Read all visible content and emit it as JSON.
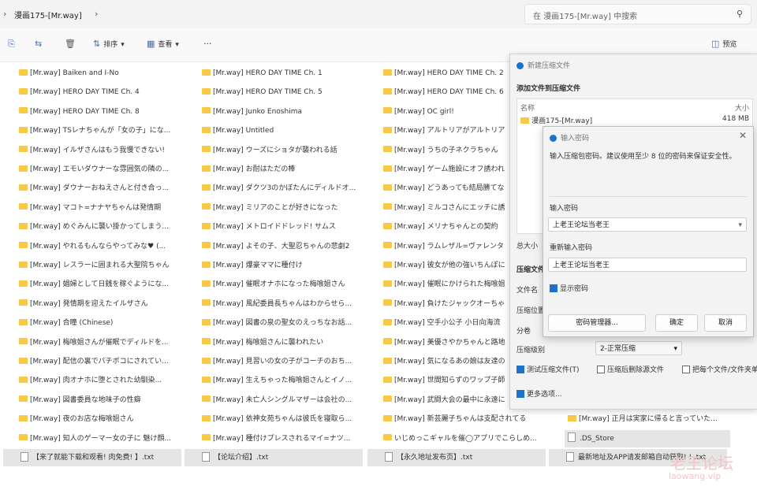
{
  "address": {
    "breadcrumb": "漫画175-[Mr.way]",
    "search_placeholder": "在 漫画175-[Mr.way] 中搜索"
  },
  "toolbar": {
    "sort": "排序",
    "view": "查看",
    "more": "···",
    "preview": "预览"
  },
  "files": {
    "col1": [
      "[Mr.way] Baiken and I-No",
      "[Mr.way] HERO DAY TIME Ch. 4",
      "[Mr.way] HERO DAY TIME Ch. 8",
      "[Mr.way] TSレナちゃんが「女の子」にな...",
      "[Mr.way] イルザさんはもう我慢できない!",
      "[Mr.way] エモいダウナーな雰囲気の隣の...",
      "[Mr.way] ダウナーおねえさんと付き合っ...",
      "[Mr.way] マコト=ナナヤちゃんは発情期",
      "[Mr.way] めぐみんに襲い掛かってしまう...",
      "[Mr.way] やれるもんならやってみな♥ (...",
      "[Mr.way] レスラーに囲まれる大聖院ちゃん",
      "[Mr.way] 娼婦として日銭を稼ぐようにな...",
      "[Mr.way] 発情期を迎えたイルザさん",
      "[Mr.way] 合瞳 (Chinese)",
      "[Mr.way] 梅喰姐さんが催眠でディルドを...",
      "[Mr.way] 配信の裏でパチボコにされてい...",
      "[Mr.way] 肉オナホに堕とされた幼馴染...",
      "[Mr.way] 図書委員な地味子の性癖",
      "[Mr.way] 夜のお店な梅喰姐さん",
      "[Mr.way] 知人のゲーマー女の子に 魅け顔..."
    ],
    "col2": [
      "[Mr.way] HERO DAY TIME Ch. 1",
      "[Mr.way] HERO DAY TIME Ch. 5",
      "[Mr.way] Junko Enoshima",
      "[Mr.way] Untitled",
      "[Mr.way] ウーズにショタが襲われる話",
      "[Mr.way] お耐はただの棒",
      "[Mr.way] ダクツ3のかぼたんにディルドオ...",
      "[Mr.way] ミリアのことが好きになった",
      "[Mr.way] メトロイドドレッド! サムス",
      "[Mr.way] よその子、大聖忍ちゃんの悲劇2",
      "[Mr.way] 爆豪ママに種付け",
      "[Mr.way] 催眠オナホになった梅喰姐さん",
      "[Mr.way] 風紀委員長ちゃんはわからせら...",
      "[Mr.way] 図書の泉の聖女のえっちなお話...",
      "[Mr.way] 梅喰姐さんに襲われたい",
      "[Mr.way] 見習いの女の子がコーチのおち...",
      "[Mr.way] 生えちゃった梅喰姐さんとイノ...",
      "[Mr.way] 未亡人シングルマザーは会社の...",
      "[Mr.way] 依神女苑ちゃんは彼氏を寝取ら...",
      "[Mr.way] 種付けプレスされるマイ=ナツ..."
    ],
    "col3": [
      "[Mr.way] HERO DAY TIME Ch. 2",
      "[Mr.way] HERO DAY TIME Ch. 6",
      "[Mr.way] OC girl!",
      "[Mr.way] アルトリアがアルトリア",
      "[Mr.way] うちの子ネクラちゃん",
      "[Mr.way] ゲーム施設にオフ誘われ",
      "[Mr.way] どうあっても結局勝てな",
      "[Mr.way] ミルコさんにエッチに誘",
      "[Mr.way] メリナちゃんとの契約",
      "[Mr.way] ラムレザル=ヴァレンタ",
      "[Mr.way] 彼女が他の強いちんぽに",
      "[Mr.way] 催眠にかけられた梅喰姐",
      "[Mr.way] 負けたジャックオーちゃ",
      "[Mr.way] 空手小公子 小日向海流",
      "[Mr.way] 美優さやかちゃんと路地",
      "[Mr.way] 気になるあの娘は友達の",
      "[Mr.way] 世間知らずのワップ子師",
      "[Mr.way] 武闘大会の最中に永遠に",
      "[Mr.way] 新芸麗子ちゃんは支配されてる",
      "いじめっこギャルを催◯アプリでこらしめ..."
    ],
    "col4_bottom": [
      "[Mr.way] 正月は実家に帰ると言っていた...",
      ".DS_Store"
    ],
    "txt_row": [
      "【来了就能下载和观看! 肉免费! 】.txt",
      "【论坛介绍】.txt",
      "【永久地址发布页】.txt",
      "最新地址及APP请发邮箱自动获取! ! .txt"
    ]
  },
  "compress_dialog": {
    "title": "新建压缩文件",
    "section": "添加文件到压缩文件",
    "col_name": "名称",
    "col_size": "大小",
    "item_name": "漫画175-[Mr.way]",
    "item_size": "418 MB",
    "lbl_total": "总大小",
    "lbl_format": "压缩文件",
    "lbl_filename": "文件名",
    "lbl_location": "压缩位置",
    "lbl_split": "分卷",
    "lbl_level": "压缩级别",
    "level_value": "2-正常压缩",
    "opt_test": "测试压缩文件(T)",
    "opt_delete": "压缩后删除源文件",
    "opt_each": "把每个文件/文件夹单独",
    "more_options": "更多选项..."
  },
  "password_dialog": {
    "title": "输入密码",
    "desc": "输入压缩包密码。建议使用至少 8 位的密码来保证安全性。",
    "lbl_password": "输入密码",
    "password_value": "上老王论坛当老王",
    "lbl_repeat": "重新输入密码",
    "repeat_value": "上老王论坛当老王",
    "show_password": "显示密码",
    "btn_manager": "密码管理器...",
    "btn_ok": "确定",
    "btn_cancel": "取消"
  },
  "watermark": {
    "line1": "老王论坛",
    "line2": "laowang.vip"
  }
}
